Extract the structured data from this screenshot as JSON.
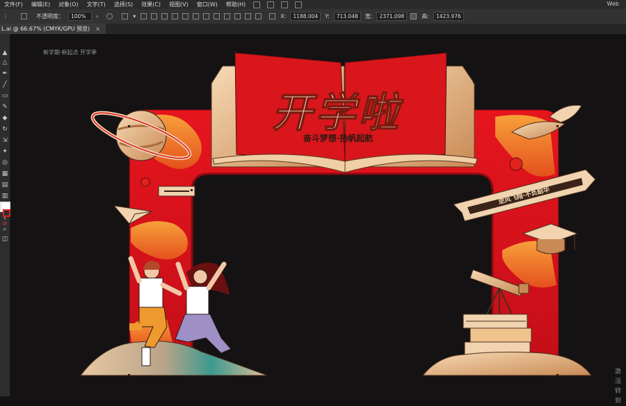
{
  "menubar": {
    "items": [
      "文件(F)",
      "编辑(E)",
      "对象(O)",
      "文字(T)",
      "选择(S)",
      "效果(C)",
      "视图(V)",
      "窗口(W)",
      "帮助(H)"
    ],
    "workspace": "Web"
  },
  "control": {
    "opacity_label": "不透明度：",
    "opacity_value": "100%",
    "x_label": "X:",
    "x_value": "1188.004",
    "y_label": "Y:",
    "y_value": "713.048",
    "w_label": "宽:",
    "w_value": "2371.098",
    "h_label": "高:",
    "h_value": "1423.976"
  },
  "tab": {
    "title": "L.ai @ 66.67% (CMYK/GPU 预览)",
    "close": "×"
  },
  "artwork": {
    "title": "开学啦",
    "subtitle": "奋斗梦想·扬帆起航",
    "banner": "逆风飞翔·不负韶华",
    "artboard_label": "新学期·新起点 开学季"
  },
  "watermark": {
    "line1": "激活",
    "line2": "转到"
  },
  "colors": {
    "ui_bg": "#323232",
    "arch_red": "#d9121b",
    "dark_red": "#8c0a12",
    "gold": "#e7b98c",
    "cream": "#f4d7b5"
  }
}
